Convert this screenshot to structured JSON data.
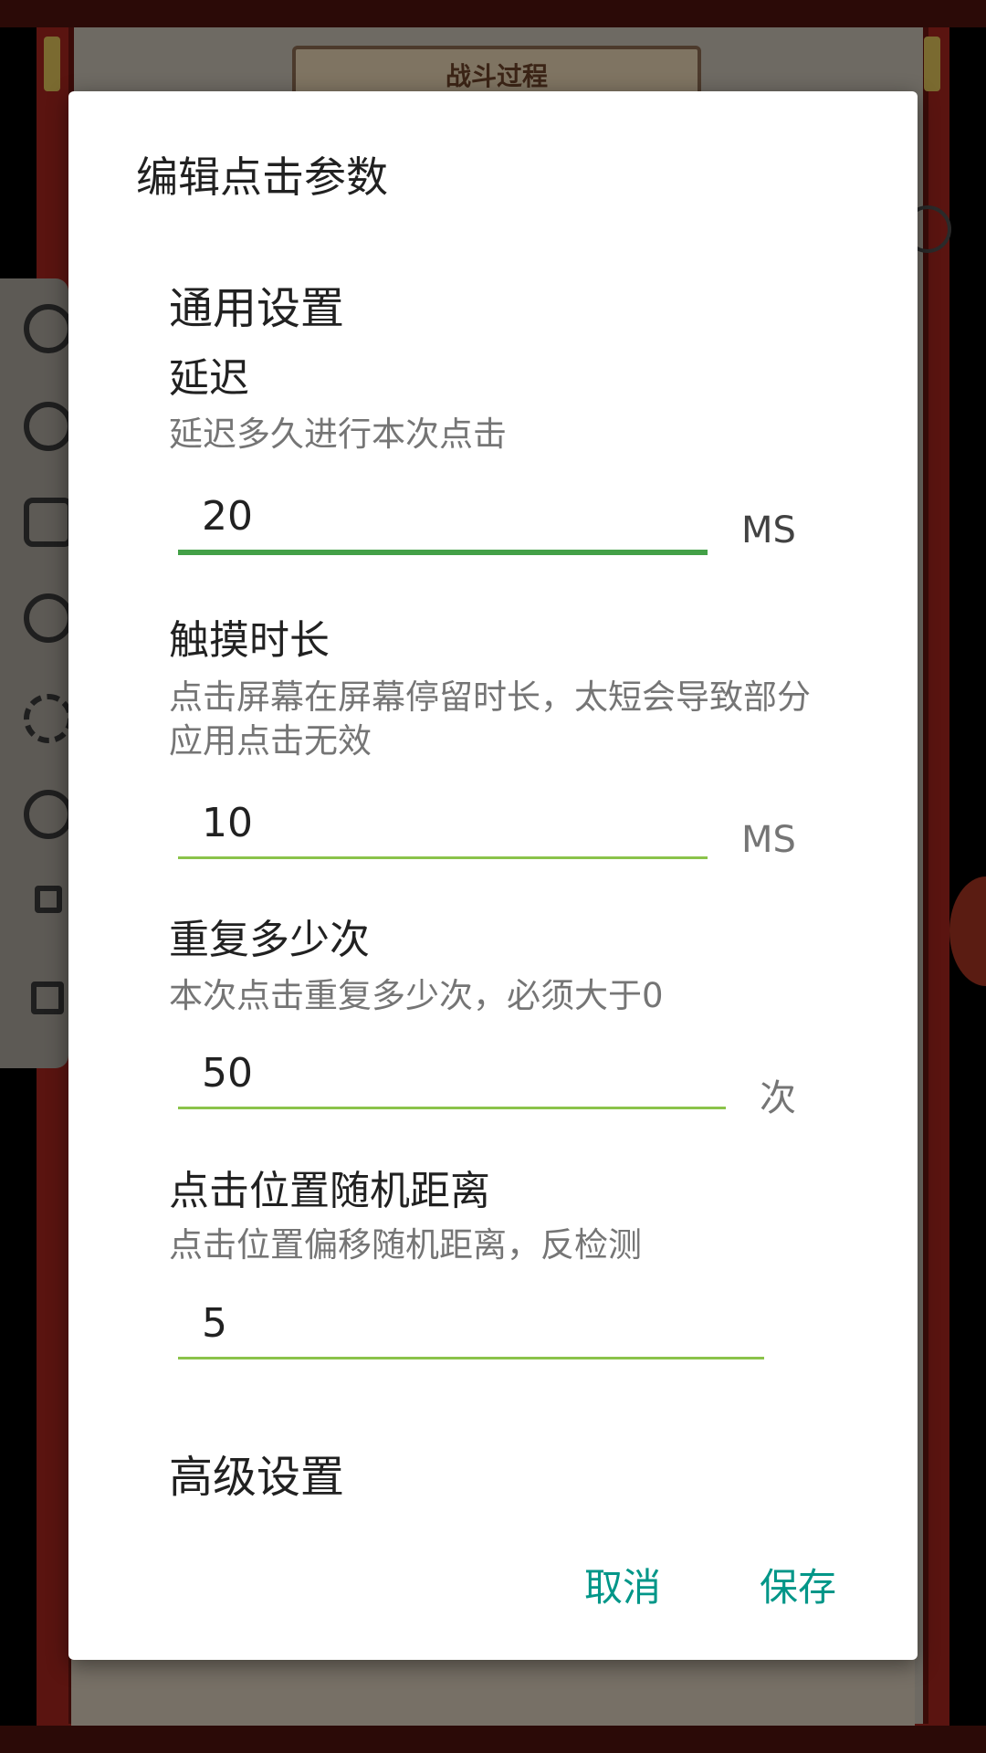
{
  "background": {
    "title": "战斗过程"
  },
  "dialog": {
    "title": "编辑点击参数",
    "general_section": "通用设置",
    "advanced_section": "高级设置",
    "fields": [
      {
        "label": "延迟",
        "description": "延迟多久进行本次点击",
        "value": "20",
        "unit": "MS"
      },
      {
        "label": "触摸时长",
        "description": "点击屏幕在屏幕停留时长，太短会导致部分应用点击无效",
        "value": "10",
        "unit": "MS"
      },
      {
        "label": "重复多少次",
        "description": "本次点击重复多少次，必须大于0",
        "value": "50",
        "unit": "次"
      },
      {
        "label": "点击位置随机距离",
        "description": "点击位置偏移随机距离，反检测",
        "value": "5",
        "unit": ""
      }
    ],
    "cancel_label": "取消",
    "save_label": "保存"
  },
  "colors": {
    "accent": "#009688",
    "focused_underline": "#43a047",
    "underline": "#8bc34a"
  }
}
